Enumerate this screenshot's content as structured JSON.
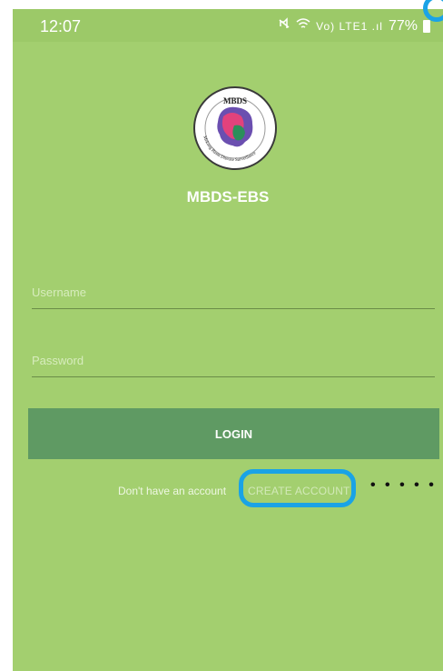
{
  "status_bar": {
    "time": "12:07",
    "indicators": "Vo) LTE1 .ıl",
    "battery": "77%"
  },
  "app": {
    "logo_text_top": "MBDS",
    "logo_text_ring": "Mekong Basin Disease Surveillance",
    "title": "MBDS-EBS"
  },
  "form": {
    "username_placeholder": "Username",
    "password_placeholder": "Password",
    "login_label": "LOGIN"
  },
  "signup": {
    "prompt": "Don't have an account",
    "create_account_label": "CREATE ACCOUNT"
  },
  "colors": {
    "background": "#a3cf6f",
    "button": "#5f9a63",
    "highlight": "#1aa3e6"
  },
  "icons": [
    "wifi-icon",
    "signal-icon",
    "battery-icon",
    "mute-icon"
  ]
}
